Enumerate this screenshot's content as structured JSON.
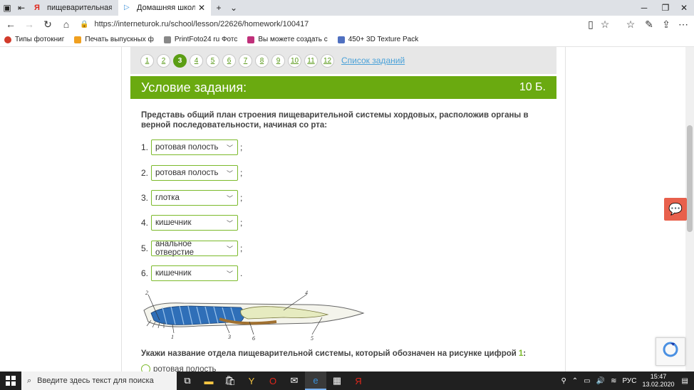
{
  "browser": {
    "tabs": [
      {
        "label": "пищеварительная система",
        "active": false
      },
      {
        "label": "Домашняя школа Inter",
        "active": true
      }
    ],
    "url": "https://interneturok.ru/school/lesson/22626/homework/100417",
    "bookmarks": [
      {
        "label": "Типы фотокниг",
        "color": "#d23b2b"
      },
      {
        "label": "Печать выпускных ф",
        "color": "#f0a020"
      },
      {
        "label": "PrintFoto24 ru Фотс",
        "color": "#888888"
      },
      {
        "label": "Вы можете создать с",
        "color": "#c0307a"
      },
      {
        "label": "450+ 3D Texture Pack",
        "color": "#5070c0"
      }
    ]
  },
  "pager": {
    "pages": [
      "1",
      "2",
      "3",
      "4",
      "5",
      "6",
      "7",
      "8",
      "9",
      "10",
      "11",
      "12"
    ],
    "current": "3",
    "tasks_link": "Список заданий"
  },
  "task": {
    "title": "Условие задания:",
    "points": "10 Б.",
    "question": "Представь общий план строения пищеварительной системы хордовых, расположив органы в верной последовательности, начиная со рта:",
    "answers": [
      {
        "num": "1.",
        "value": "ротовая полость",
        "punct": ";"
      },
      {
        "num": "2.",
        "value": "ротовая полость",
        "punct": ";"
      },
      {
        "num": "3.",
        "value": "глотка",
        "punct": ";"
      },
      {
        "num": "4.",
        "value": "кишечник",
        "punct": ";"
      },
      {
        "num": "5.",
        "value": "анальное отверстие",
        "punct": ";"
      },
      {
        "num": "6.",
        "value": "кишечник",
        "punct": "."
      }
    ],
    "figure_labels": [
      "2",
      "4",
      "1",
      "3",
      "6",
      "5"
    ],
    "question2": "Укажи название отдела пищеварительной системы, который обозначен на рисунке цифрой",
    "question2_num": "1",
    "question2_suffix": ":",
    "option1": "ротовая полость"
  },
  "taskbar": {
    "search_placeholder": "Введите здесь текст для поиска",
    "lang": "РУС",
    "time": "15:47",
    "date": "13.02.2020"
  }
}
